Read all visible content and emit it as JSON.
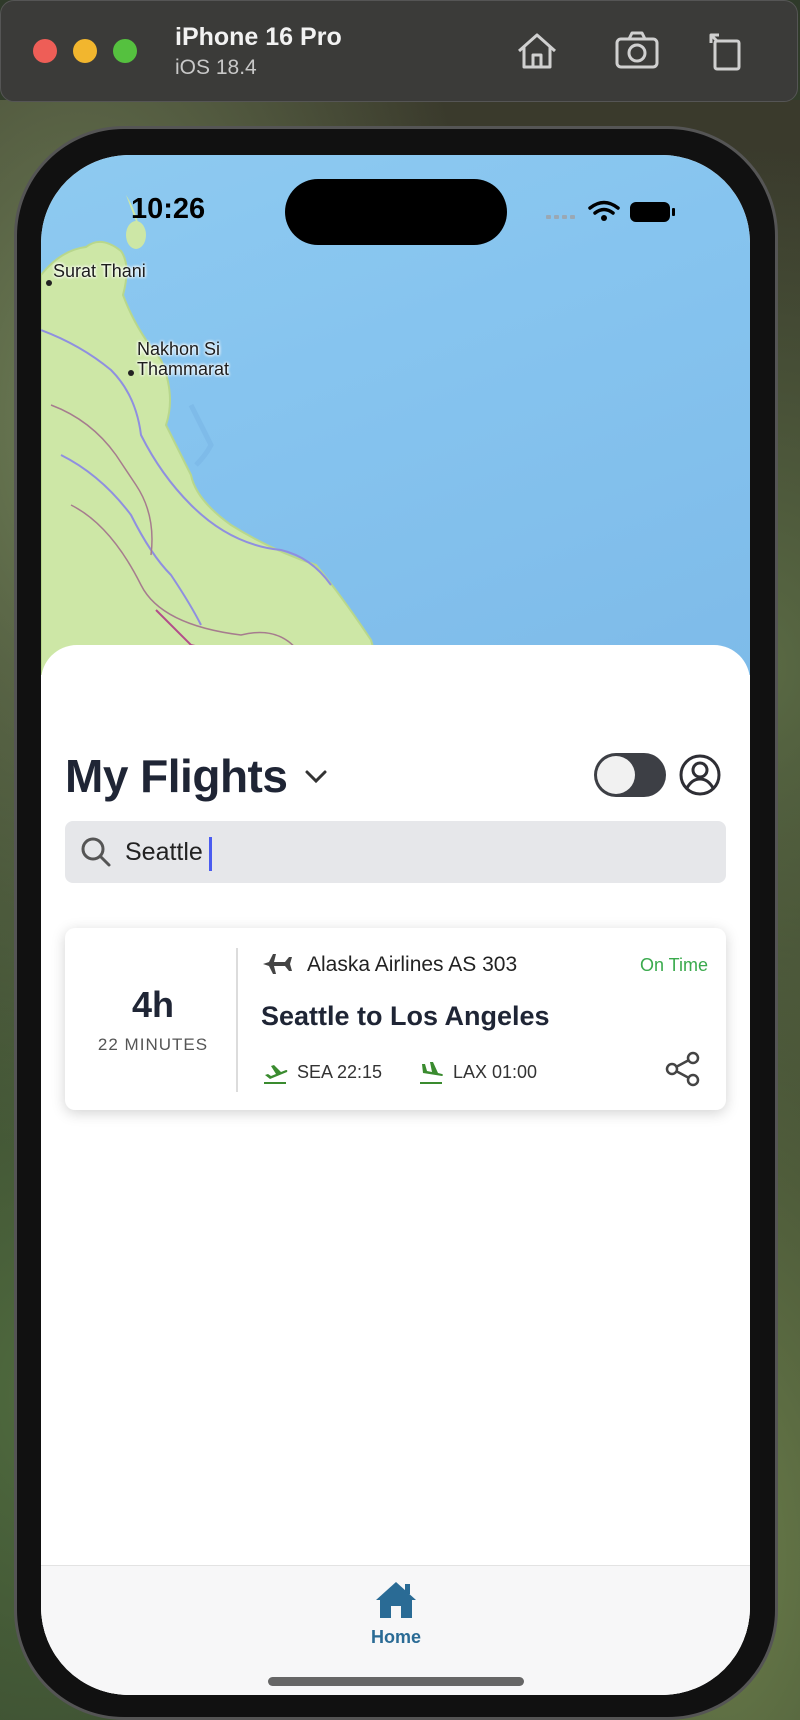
{
  "window": {
    "device_name": "iPhone 16 Pro",
    "os_version": "iOS 18.4"
  },
  "status_bar": {
    "time": "10:26"
  },
  "map": {
    "labels": [
      "Surat Thani",
      "Nakhon Si",
      "Thammarat"
    ]
  },
  "header": {
    "title": "My Flights"
  },
  "search": {
    "value": "Seattle",
    "placeholder": ""
  },
  "flight_card": {
    "duration_hours": "4h",
    "duration_minutes": "22 MINUTES",
    "airline": "Alaska Airlines AS 303",
    "status": "On Time",
    "status_color": "#3aaa4d",
    "route": "Seattle to Los Angeles",
    "departure": "SEA 22:15",
    "arrival": "LAX 01:00"
  },
  "tabbar": {
    "home_label": "Home",
    "accent": "#2a6b95"
  }
}
